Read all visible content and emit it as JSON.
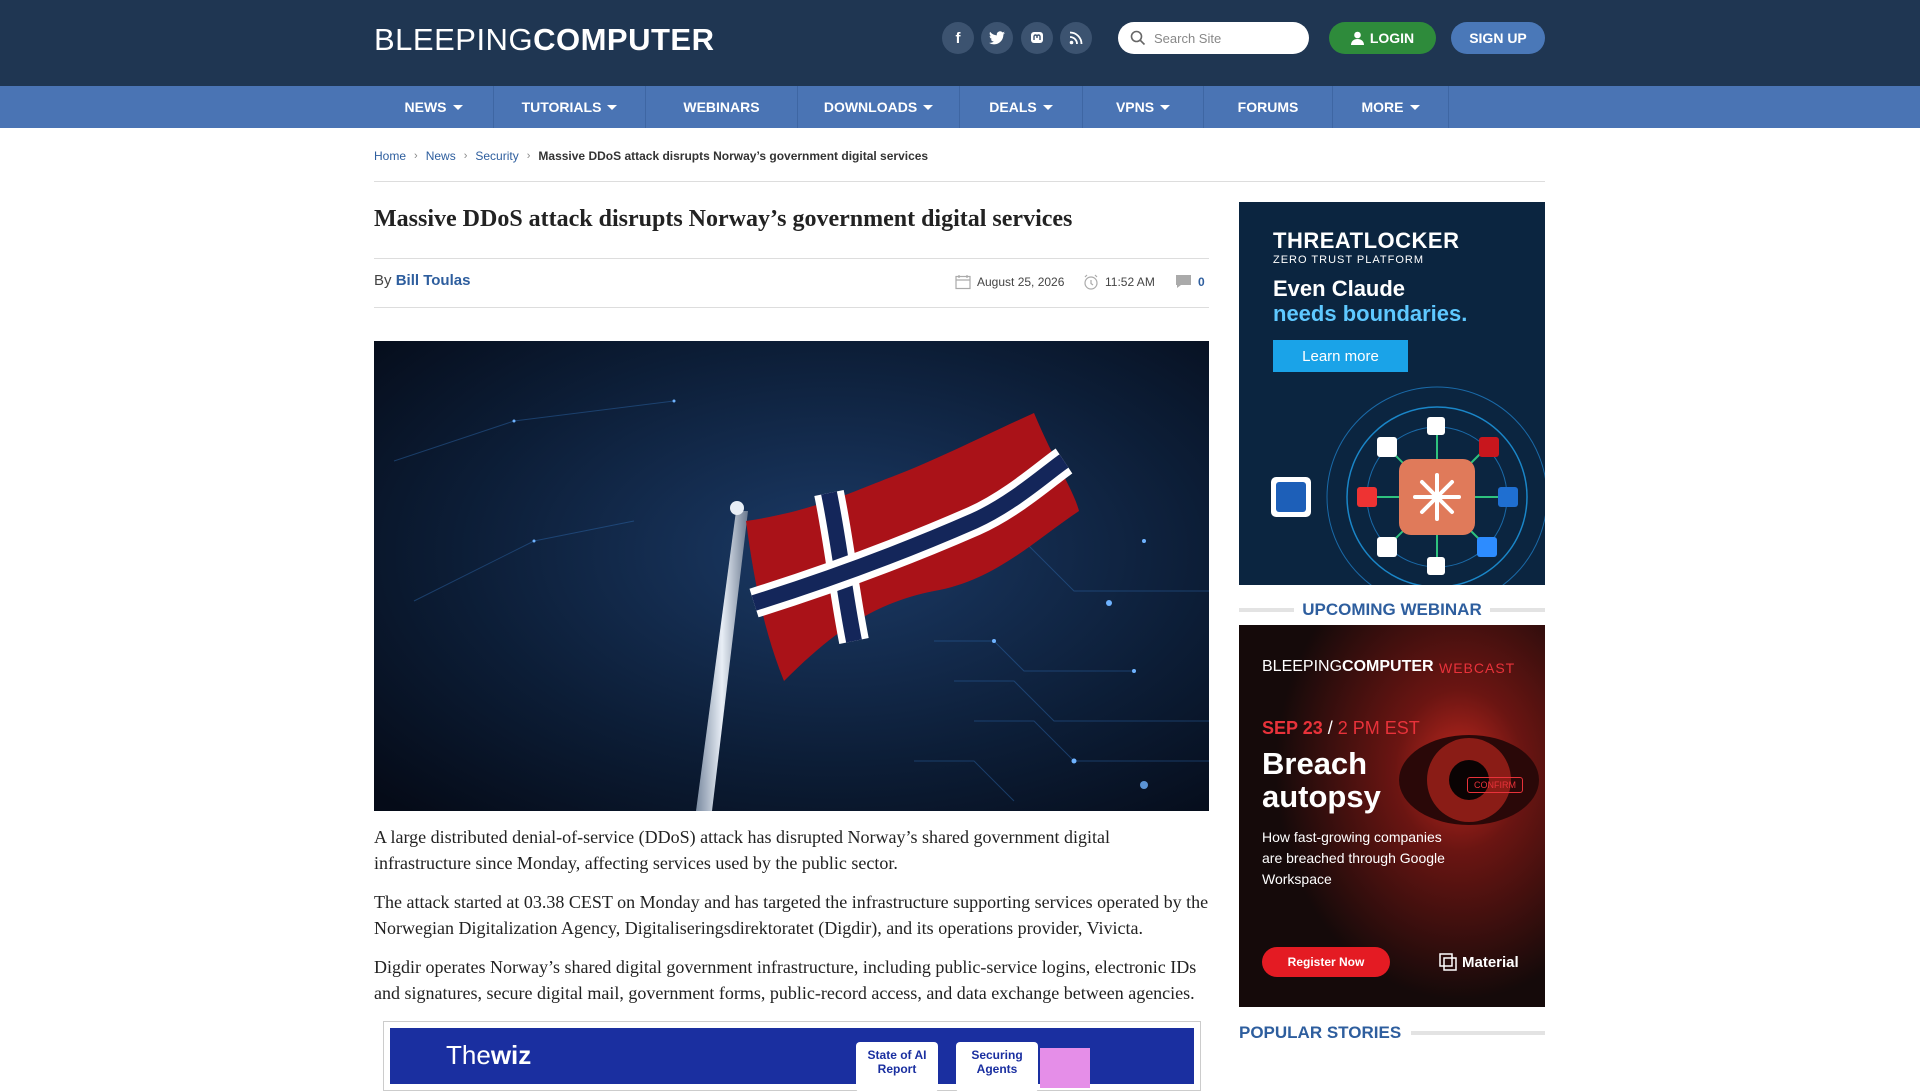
{
  "header": {
    "logo_light": "BLEEPING",
    "logo_bold": "COMPUTER",
    "social": [
      "facebook-icon",
      "twitter-icon",
      "mastodon-icon",
      "rss-icon"
    ],
    "search_placeholder": "Search Site",
    "login_label": "LOGIN",
    "signup_label": "SIGN UP"
  },
  "nav": {
    "items": [
      {
        "label": "NEWS",
        "dropdown": true
      },
      {
        "label": "TUTORIALS",
        "dropdown": true
      },
      {
        "label": "WEBINARS",
        "dropdown": false
      },
      {
        "label": "DOWNLOADS",
        "dropdown": true
      },
      {
        "label": "DEALS",
        "dropdown": true
      },
      {
        "label": "VPNS",
        "dropdown": true
      },
      {
        "label": "FORUMS",
        "dropdown": false
      },
      {
        "label": "MORE",
        "dropdown": true
      }
    ]
  },
  "breadcrumb": {
    "home": "Home",
    "news": "News",
    "security": "Security",
    "current": "Massive DDoS attack disrupts Norway’s government digital services"
  },
  "article": {
    "title": "Massive DDoS attack disrupts Norway’s government digital services",
    "by": "By",
    "author": "Bill Toulas",
    "date": "August 25, 2026",
    "time": "11:52 AM",
    "comments": "0",
    "paragraphs": [
      "A large distributed denial-of-service (DDoS) attack has disrupted Norway’s shared government digital infrastructure since Monday, affecting services used by the public sector.",
      "The attack started at 03.38 CEST on Monday and has targeted  the infrastructure supporting services operated by the Norwegian Digitalization Agency, Digitaliseringsdirektoratet (Digdir), and its operations provider, Vivicta.",
      "Digdir operates Norway’s shared digital government infrastructure, including public-service logins, electronic IDs and signatures, secure digital mail, government forms, public-record access, and data exchange between agencies."
    ]
  },
  "inline_ad": {
    "brand": "The",
    "brand_bold": "wiz",
    "card1": "State of AI Report",
    "card2": "Securing Agents"
  },
  "sidebar": {
    "ad1": {
      "brand": "THREATLOCKER",
      "tagline": "ZERO TRUST PLATFORM",
      "headline1": "Even Claude",
      "headline2": "needs boundaries.",
      "cta": "Learn more"
    },
    "webinar_heading": "UPCOMING WEBINAR",
    "ad2": {
      "brand_light": "BLEEPING",
      "brand_bold": "COMPUTER",
      "tag": "WEBCAST",
      "date": "SEP 23",
      "slash": "/",
      "time": "2 PM EST",
      "headline1": "Breach",
      "headline2": "autopsy",
      "sub": "How fast-growing companies are breached through Google Workspace",
      "cta": "Register Now",
      "sponsor": "Material",
      "confirm": "CONFIRM"
    },
    "popular_heading": "POPULAR STORIES"
  }
}
